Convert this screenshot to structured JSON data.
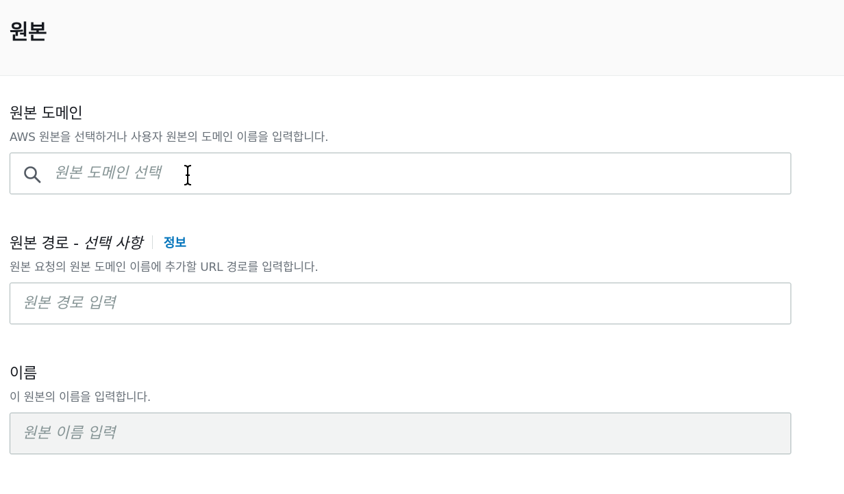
{
  "section": {
    "title": "원본"
  },
  "origin_domain": {
    "label": "원본 도메인",
    "description": "AWS 원본을 선택하거나 사용자 원본의 도메인 이름을 입력합니다.",
    "placeholder": "원본 도메인 선택",
    "value": "",
    "icon": "search-icon"
  },
  "origin_path": {
    "label": "원본 경로 - ",
    "label_optional": "선택 사항",
    "info_link": "정보",
    "description": "원본 요청의 원본 도메인 이름에 추가할 URL 경로를 입력합니다.",
    "placeholder": "원본 경로 입력",
    "value": ""
  },
  "origin_name": {
    "label": "이름",
    "description": "이 원본의 이름을 입력합니다.",
    "placeholder": "원본 이름 입력",
    "value": "",
    "disabled": true
  },
  "colors": {
    "link": "#0073bb",
    "description_text": "#687078",
    "placeholder_text": "#879596",
    "input_border": "#aab7b8",
    "disabled_background": "#f2f3f3"
  }
}
